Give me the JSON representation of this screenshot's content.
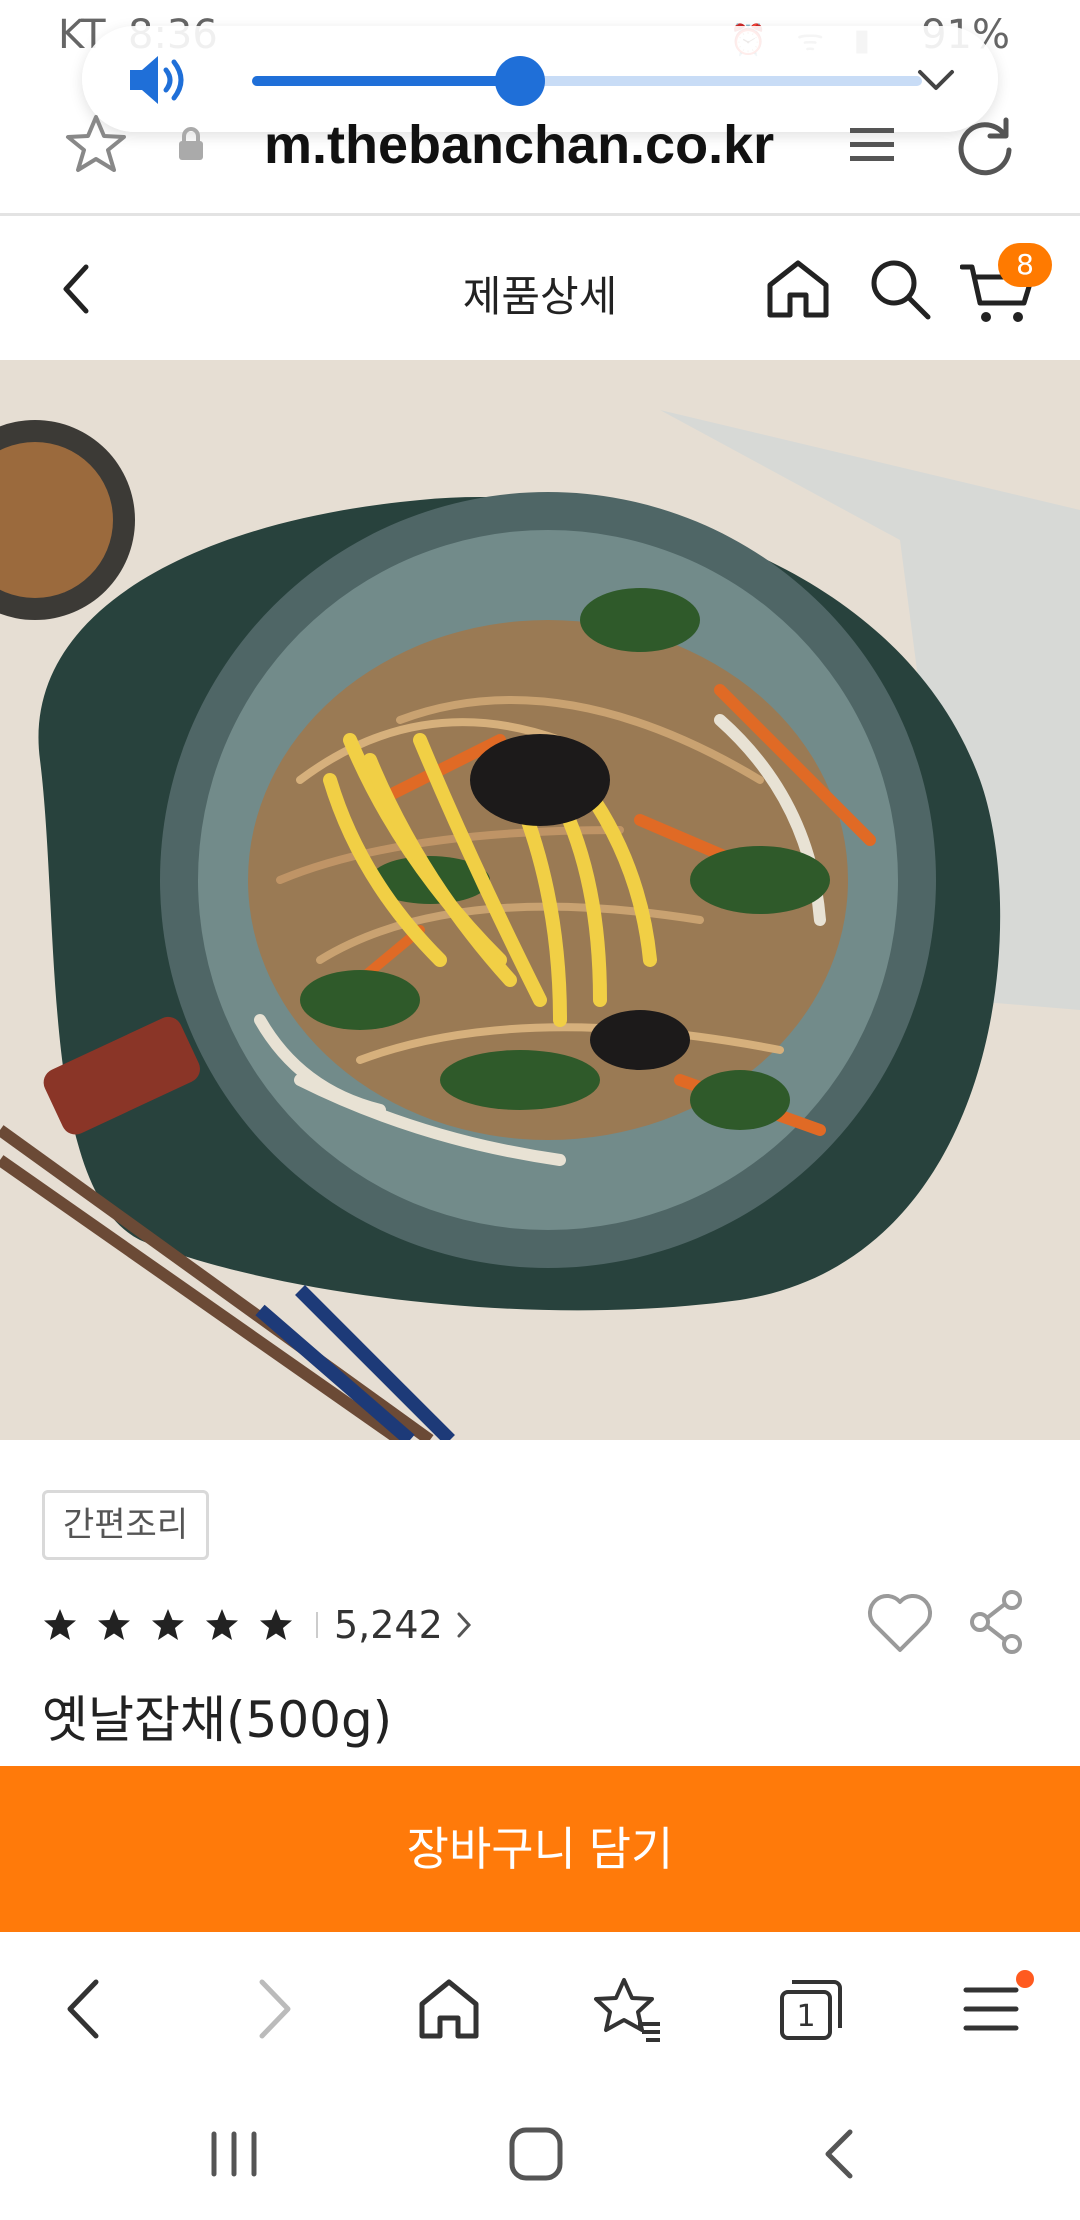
{
  "status_bar": {
    "carrier": "KT",
    "time": "8:36",
    "battery": "91%"
  },
  "volume": {
    "level": 0.4,
    "color": "#1f6fd8"
  },
  "address_bar": {
    "url": "m.thebanchan.co.kr"
  },
  "header": {
    "title": "제품상세",
    "cart_count": "8"
  },
  "product": {
    "category_tag": "간편조리",
    "rating_stars": 5,
    "review_count": "5,242",
    "name": "옛날잡채(500g)"
  },
  "cta": {
    "add_to_cart": "장바구니 담기",
    "color": "#ff7a0a"
  },
  "browser_bar": {
    "tabs_count": "1"
  },
  "icons": [
    "volume-icon",
    "chevron-down-icon",
    "star-icon",
    "lock-icon",
    "reader-icon",
    "reload-icon",
    "back-icon",
    "home-icon",
    "search-icon",
    "cart-icon",
    "heart-icon",
    "share-icon",
    "forward-icon",
    "bookmark-icon",
    "tabs-icon",
    "menu-icon",
    "recent-apps-icon",
    "system-home-icon",
    "system-back-icon"
  ]
}
